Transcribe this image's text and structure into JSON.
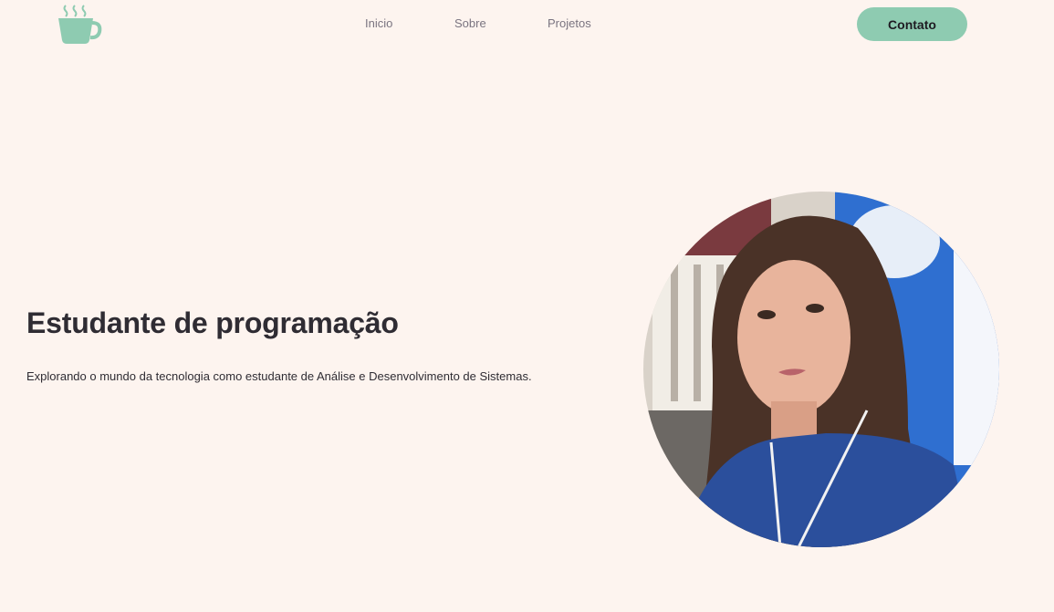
{
  "header": {
    "logo": {
      "icon": "coffee-cup-icon",
      "color": "#8ecbb1"
    },
    "nav": [
      {
        "label": "Inicio"
      },
      {
        "label": "Sobre"
      },
      {
        "label": "Projetos"
      }
    ],
    "contact_label": "Contato"
  },
  "hero": {
    "title": "Estudante de programação",
    "description": "Explorando o mundo da tecnologia como estudante de Análise e Desenvolvimento de Sistemas.",
    "portrait_icon": "profile-photo"
  },
  "colors": {
    "background": "#fdf4ef",
    "accent": "#8ecbb1",
    "text": "#2f2c33",
    "nav_text": "#7a7480"
  }
}
